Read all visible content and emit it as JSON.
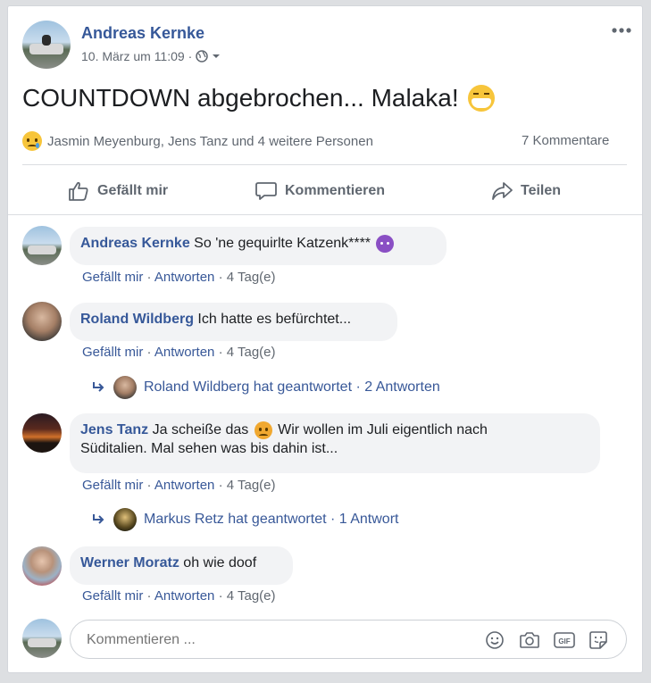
{
  "post": {
    "author": "Andreas Kernke",
    "date": "10. März um 11:09 ·",
    "text": "COUNTDOWN abgebrochen... Malaka!",
    "reactions_text": "Jasmin Meyenburg, Jens Tanz und 4 weitere Personen",
    "comments_count": "7 Kommentare",
    "audience_icon": "globe-icon",
    "more_icon": "ellipsis-icon"
  },
  "action_bar": {
    "like": "Gefällt mir",
    "comment": "Kommentieren",
    "share": "Teilen"
  },
  "comments": [
    {
      "author": "Andreas Kernke",
      "text": "So 'ne gequirlte Katzenk****",
      "like": "Gefällt mir",
      "reply": "Antworten",
      "time": "4 Tag(e)"
    },
    {
      "author": "Roland Wildberg",
      "text": "Ich hatte es befürchtet...",
      "like": "Gefällt mir",
      "reply": "Antworten",
      "time": "4 Tag(e)",
      "replies": "Roland Wildberg hat geantwortet · 2 Antworten"
    },
    {
      "author": "Jens Tanz",
      "text_line1a": "Ja scheiße das",
      "text_line1b": "Wir wollen im Juli eigentlich nach",
      "text_line2": "Süditalien. Mal sehen was bis dahin ist...",
      "like": "Gefällt mir",
      "reply": "Antworten",
      "time": "4 Tag(e)",
      "replies": "Markus Retz hat geantwortet · 1 Antwort"
    },
    {
      "author": "Werner Moratz",
      "text": "oh wie doof",
      "like": "Gefällt mir",
      "reply": "Antworten",
      "time": "4 Tag(e)"
    }
  ],
  "composer": {
    "placeholder": "Kommentieren ..."
  },
  "separator": "·"
}
